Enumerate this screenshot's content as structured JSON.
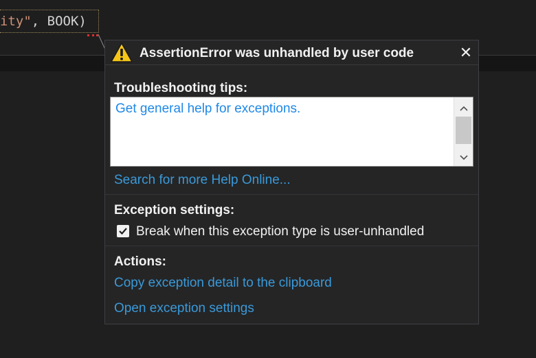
{
  "editor": {
    "code_string_part": "ity\"",
    "code_rest": ", BOOK)"
  },
  "popup": {
    "title": "AssertionError was unhandled by user code",
    "close_glyph": "✕",
    "icon": "warning-icon",
    "troubleshooting": {
      "heading": "Troubleshooting tips:",
      "tips": [
        "Get general help for exceptions."
      ],
      "search_link": "Search for more Help Online..."
    },
    "exception_settings": {
      "heading": "Exception settings:",
      "checkbox_label": "Break when this exception type is user-unhandled",
      "checked": true
    },
    "actions": {
      "heading": "Actions:",
      "copy_link": "Copy exception detail to the clipboard",
      "open_link": "Open exception settings"
    }
  },
  "colors": {
    "background": "#1e1e1e",
    "popup_bg": "#252526",
    "link": "#3a9ad9",
    "warning_yellow": "#f5c518"
  }
}
